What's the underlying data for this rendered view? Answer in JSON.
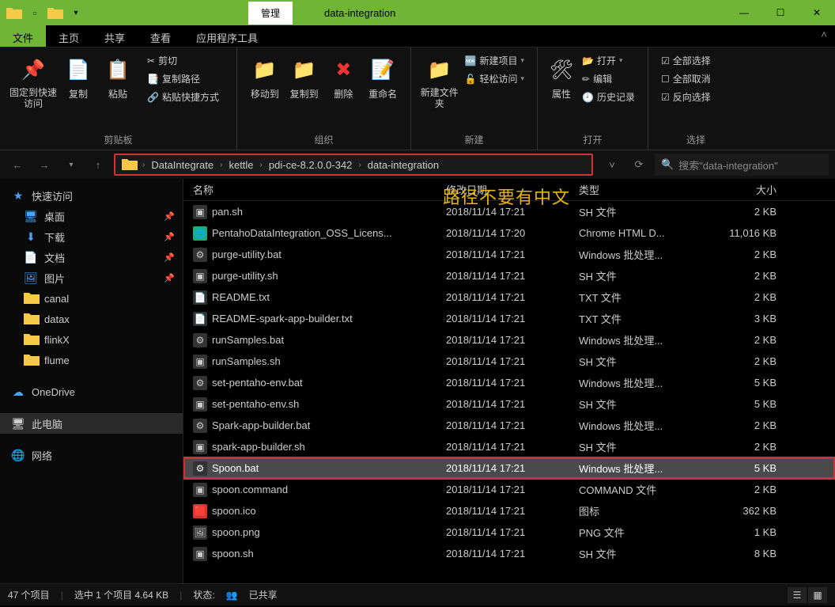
{
  "titlebar": {
    "manage_tab": "管理",
    "title": "data-integration"
  },
  "menu": {
    "file": "文件",
    "home": "主页",
    "share": "共享",
    "view": "查看",
    "app_tools": "应用程序工具"
  },
  "ribbon": {
    "pin_to_quick": "固定到快速访问",
    "copy": "复制",
    "paste": "粘贴",
    "cut": "剪切",
    "copy_path": "复制路径",
    "paste_shortcut": "粘贴快捷方式",
    "clipboard_label": "剪贴板",
    "move_to": "移动到",
    "copy_to": "复制到",
    "delete": "删除",
    "rename": "重命名",
    "organize_label": "组织",
    "new_folder": "新建文件夹",
    "new_item": "新建项目",
    "easy_access": "轻松访问",
    "new_label": "新建",
    "properties": "属性",
    "open": "打开",
    "edit": "编辑",
    "history": "历史记录",
    "open_label": "打开",
    "select_all": "全部选择",
    "select_none": "全部取消",
    "invert_selection": "反向选择",
    "select_label": "选择"
  },
  "breadcrumb": {
    "items": [
      "DataIntegrate",
      "kettle",
      "pdi-ce-8.2.0.0-342",
      "data-integration"
    ]
  },
  "search": {
    "placeholder": "搜索\"data-integration\""
  },
  "sidebar": {
    "quick_access": "快速访问",
    "desktop": "桌面",
    "downloads": "下载",
    "documents": "文档",
    "pictures": "图片",
    "canal": "canal",
    "datax": "datax",
    "flinkx": "flinkX",
    "flume": "flume",
    "onedrive": "OneDrive",
    "this_pc": "此电脑",
    "network": "网络"
  },
  "columns": {
    "name": "名称",
    "date": "修改日期",
    "type": "类型",
    "size": "大小"
  },
  "annotation": "路径不要有中文",
  "files": [
    {
      "name": "pan.sh",
      "date": "2018/11/14 17:21",
      "type": "SH 文件",
      "size": "2 KB",
      "icon": "sh"
    },
    {
      "name": "PentahoDataIntegration_OSS_Licens...",
      "date": "2018/11/14 17:20",
      "type": "Chrome HTML D...",
      "size": "11,016 KB",
      "icon": "chrome"
    },
    {
      "name": "purge-utility.bat",
      "date": "2018/11/14 17:21",
      "type": "Windows 批处理...",
      "size": "2 KB",
      "icon": "bat"
    },
    {
      "name": "purge-utility.sh",
      "date": "2018/11/14 17:21",
      "type": "SH 文件",
      "size": "2 KB",
      "icon": "sh"
    },
    {
      "name": "README.txt",
      "date": "2018/11/14 17:21",
      "type": "TXT 文件",
      "size": "2 KB",
      "icon": "txt"
    },
    {
      "name": "README-spark-app-builder.txt",
      "date": "2018/11/14 17:21",
      "type": "TXT 文件",
      "size": "3 KB",
      "icon": "txt"
    },
    {
      "name": "runSamples.bat",
      "date": "2018/11/14 17:21",
      "type": "Windows 批处理...",
      "size": "2 KB",
      "icon": "bat"
    },
    {
      "name": "runSamples.sh",
      "date": "2018/11/14 17:21",
      "type": "SH 文件",
      "size": "2 KB",
      "icon": "sh"
    },
    {
      "name": "set-pentaho-env.bat",
      "date": "2018/11/14 17:21",
      "type": "Windows 批处理...",
      "size": "5 KB",
      "icon": "bat"
    },
    {
      "name": "set-pentaho-env.sh",
      "date": "2018/11/14 17:21",
      "type": "SH 文件",
      "size": "5 KB",
      "icon": "sh"
    },
    {
      "name": "Spark-app-builder.bat",
      "date": "2018/11/14 17:21",
      "type": "Windows 批处理...",
      "size": "2 KB",
      "icon": "bat"
    },
    {
      "name": "spark-app-builder.sh",
      "date": "2018/11/14 17:21",
      "type": "SH 文件",
      "size": "2 KB",
      "icon": "sh"
    },
    {
      "name": "Spoon.bat",
      "date": "2018/11/14 17:21",
      "type": "Windows 批处理...",
      "size": "5 KB",
      "icon": "bat",
      "selected": true,
      "highlighted": true
    },
    {
      "name": "spoon.command",
      "date": "2018/11/14 17:21",
      "type": "COMMAND 文件",
      "size": "2 KB",
      "icon": "cmd"
    },
    {
      "name": "spoon.ico",
      "date": "2018/11/14 17:21",
      "type": "图标",
      "size": "362 KB",
      "icon": "ico"
    },
    {
      "name": "spoon.png",
      "date": "2018/11/14 17:21",
      "type": "PNG 文件",
      "size": "1 KB",
      "icon": "png"
    },
    {
      "name": "spoon.sh",
      "date": "2018/11/14 17:21",
      "type": "SH 文件",
      "size": "8 KB",
      "icon": "sh"
    }
  ],
  "status": {
    "items": "47 个项目",
    "selected": "选中 1 个项目 4.64 KB",
    "state_label": "状态:",
    "shared": "已共享"
  }
}
